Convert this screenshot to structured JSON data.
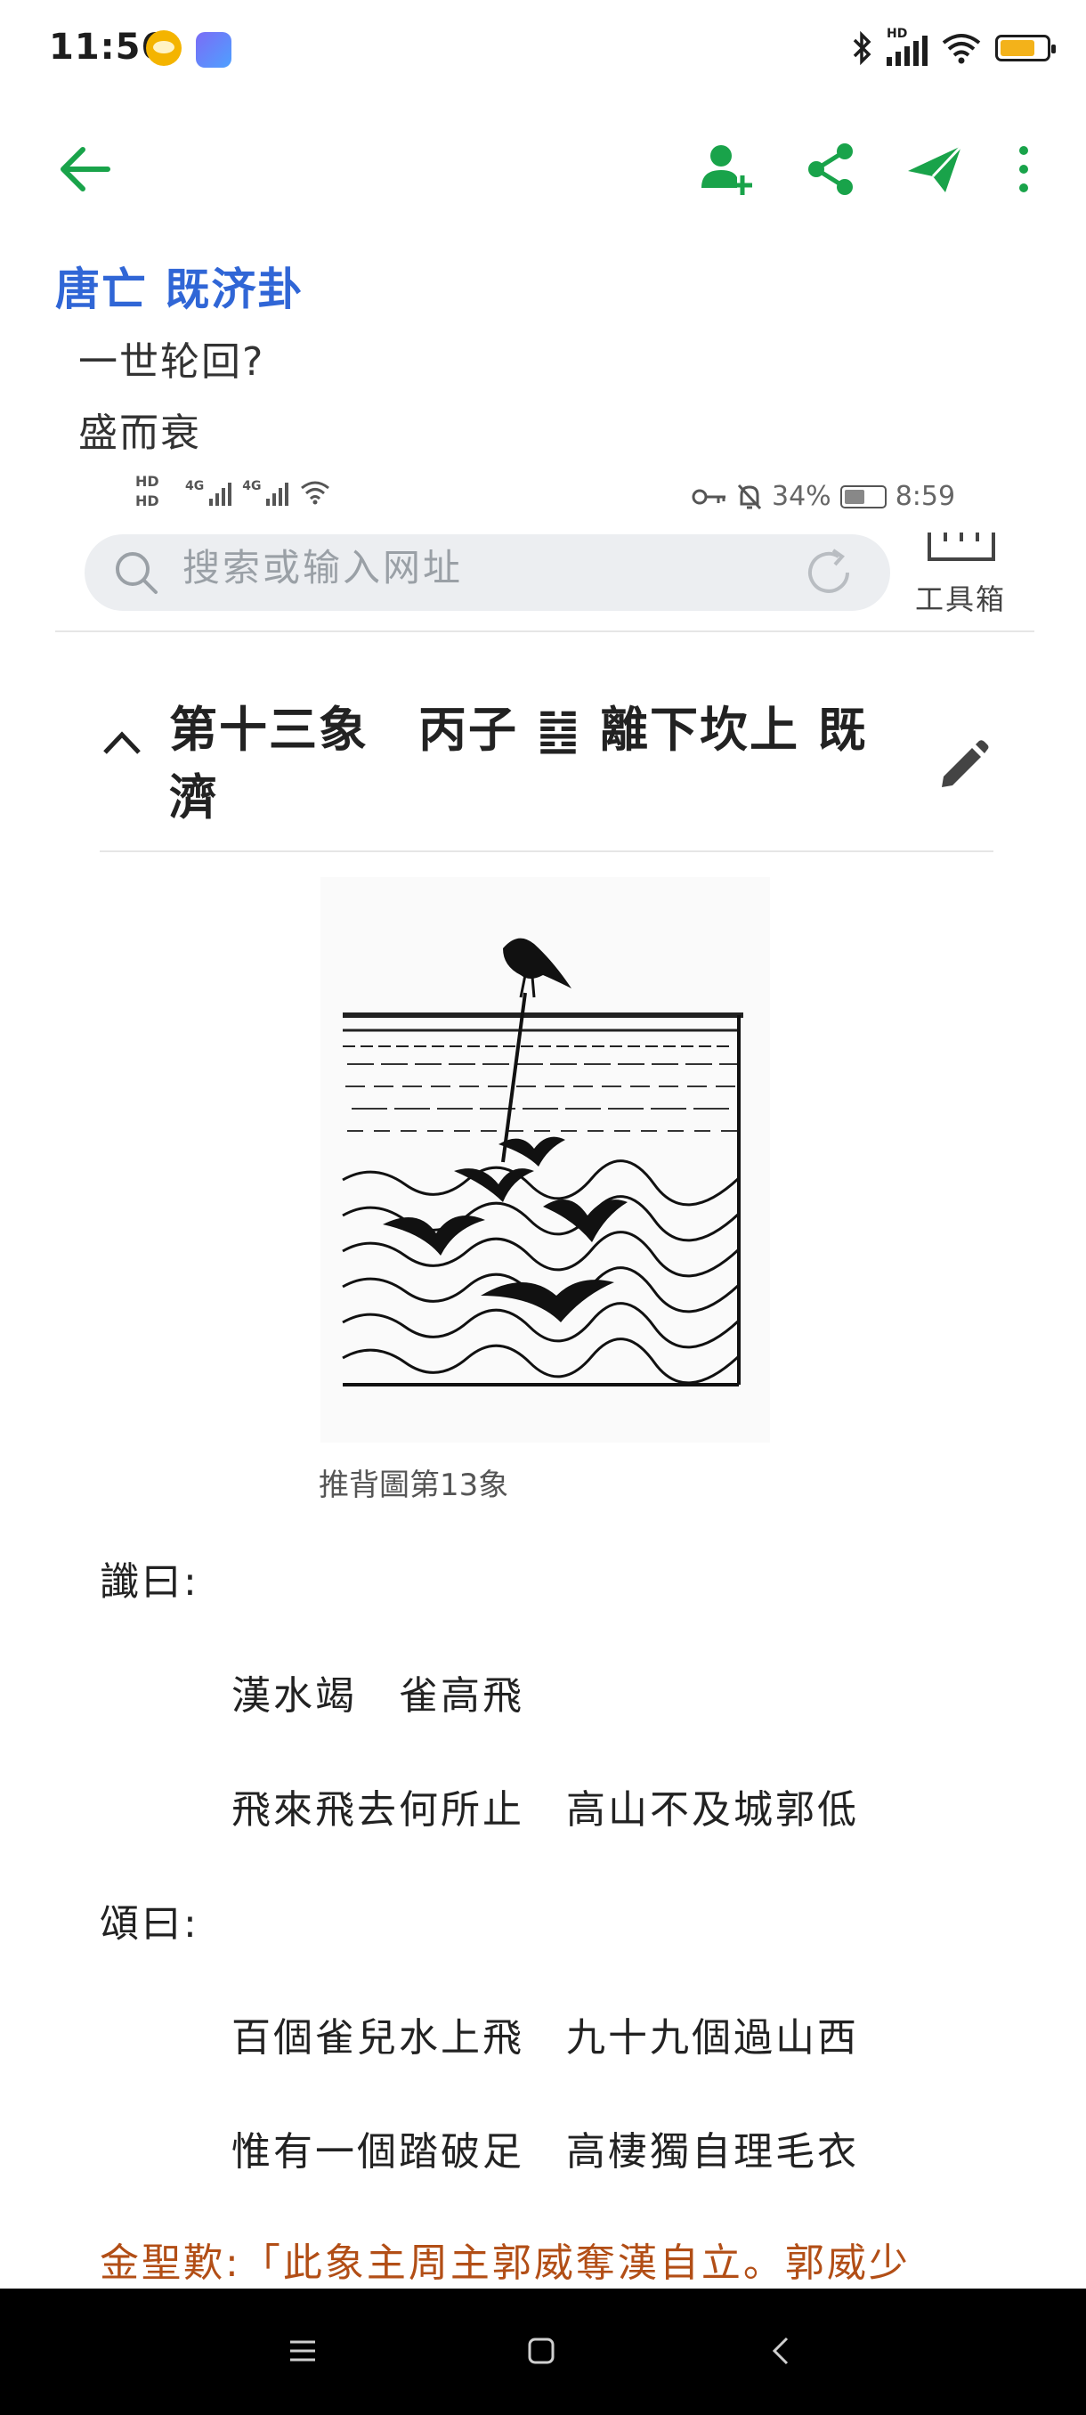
{
  "status_bar": {
    "time": "11:56",
    "network_badge": "HD",
    "icons": [
      "bluetooth-icon",
      "signal-icon",
      "wifi-icon",
      "battery-icon"
    ],
    "battery_color": "#f3b21a"
  },
  "app_bar": {
    "icons": [
      "back-arrow-icon",
      "add-person-icon",
      "share-icon",
      "send-icon",
      "more-icon"
    ],
    "accent_color": "#19a34a"
  },
  "note": {
    "title": "唐亡 既济卦",
    "lines": [
      "一世轮回?",
      "盛而衰"
    ]
  },
  "embedded": {
    "status": {
      "badge_top": "HD",
      "badge_bottom": "HD",
      "net1": "4G",
      "net2": "4G",
      "battery": "34%",
      "time": "8:59"
    },
    "search": {
      "placeholder": "搜索或输入网址",
      "toolbox_label": "工具箱"
    },
    "section": {
      "title": "第十三象　丙子 ䷾ 離下坎上 既濟"
    },
    "image_caption": "推背圖第13象",
    "poem": {
      "chen_label": "讖曰:",
      "chen_lines": [
        "漢水竭　雀高飛",
        "飛來飛去何所止　高山不及城郭低"
      ],
      "song_label": "頌曰:",
      "song_lines": [
        "百個雀兒水上飛　九十九個過山西",
        "惟有一個踏破足　高棲獨自理毛衣"
      ]
    },
    "commentary": "金聖歎:「此象主周主郭威奪漢自立。郭威少"
  },
  "nav_bar": {
    "icons": [
      "menu-icon",
      "home-icon",
      "back-icon"
    ]
  }
}
